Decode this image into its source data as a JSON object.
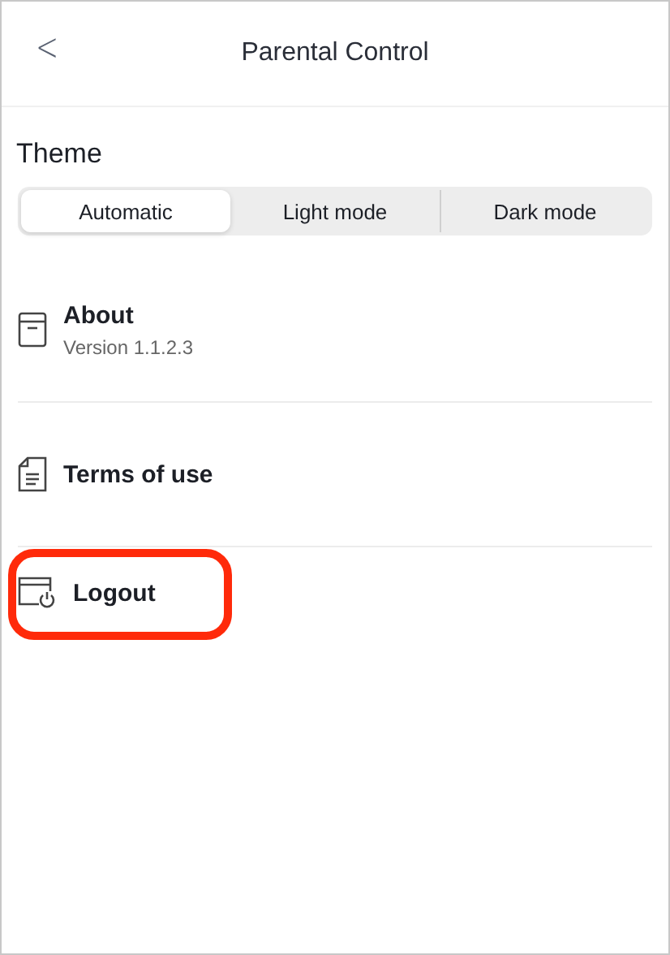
{
  "header": {
    "back": "<",
    "title": "Parental Control"
  },
  "theme": {
    "title": "Theme",
    "options": [
      {
        "label": "Automatic",
        "selected": true
      },
      {
        "label": "Light mode",
        "selected": false
      },
      {
        "label": "Dark mode",
        "selected": false
      }
    ]
  },
  "items": [
    {
      "kind": "about",
      "label": "About",
      "subtitle": "Version 1.1.2.3",
      "highlighted": false
    },
    {
      "kind": "terms",
      "label": "Terms of use",
      "highlighted": false
    },
    {
      "kind": "logout",
      "label": "Logout",
      "highlighted": true
    }
  ]
}
